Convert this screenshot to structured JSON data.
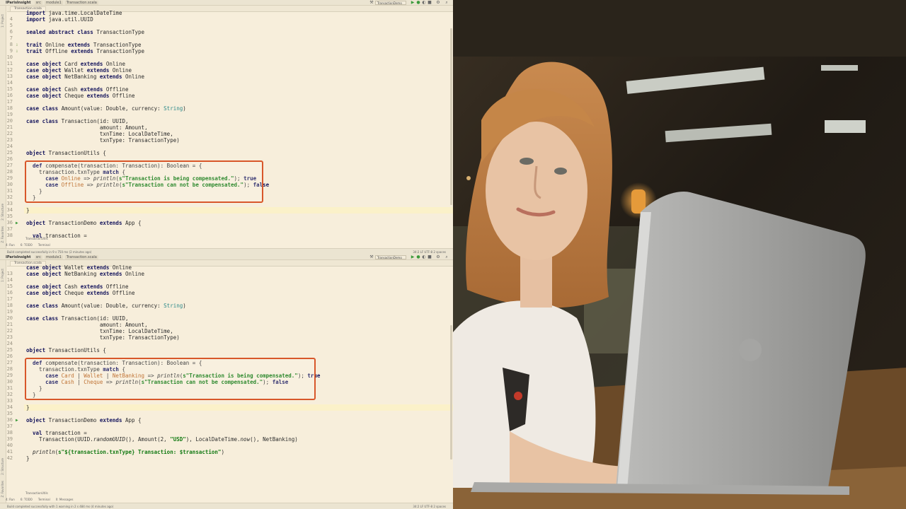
{
  "ide": {
    "breadcrumbs": [
      "IParisInsight",
      "src",
      "module1",
      "Transaction.scala"
    ],
    "tab_label": "Transaction.scala",
    "run_config": "TransactionDemo",
    "side_tool_windows": [
      "1: Project",
      "2: Structure",
      "Z: Favorites"
    ],
    "bottom_tool_windows": [
      "4: Run",
      "6: TODO",
      "Terminal"
    ],
    "bottom_tool_windows_full": [
      "4: Run",
      "6: TODO",
      "Terminal",
      "0: Messages"
    ],
    "structure_crumb": "TransactionUtils",
    "status_top": "Build completed successfully in 9 s 750 ms (2 minutes ago)",
    "status_bottom": "Build completed successfully with 1 warning in 2 s 484 ms (4 minutes ago)",
    "status_right_top": "34:2  LF  UTF-8  2 spaces",
    "status_right_bottom": "34:2  LF  UTF-8  2 spaces",
    "event_log": "Event Log",
    "colors": {
      "highlight_border": "#d8572a",
      "background": "#f7eedb",
      "keyword": "#14145c",
      "string": "#137a13"
    },
    "icons": [
      "run-icon",
      "debug-icon",
      "stop-icon",
      "search-icon"
    ]
  },
  "editor_top": {
    "lines": [
      {
        "n": "",
        "text": "import java.time.LocalDateTime"
      },
      {
        "n": "4",
        "text": "import java.util.UUID"
      },
      {
        "n": "5",
        "text": ""
      },
      {
        "n": "6",
        "text": "sealed abstract class TransactionType"
      },
      {
        "n": "7",
        "text": ""
      },
      {
        "n": "8",
        "text": "trait Online extends TransactionType"
      },
      {
        "n": "9",
        "text": "trait Offline extends TransactionType"
      },
      {
        "n": "10",
        "text": ""
      },
      {
        "n": "11",
        "text": "case object Card extends Online"
      },
      {
        "n": "12",
        "text": "case object Wallet extends Online"
      },
      {
        "n": "13",
        "text": "case object NetBanking extends Online"
      },
      {
        "n": "14",
        "text": ""
      },
      {
        "n": "15",
        "text": "case object Cash extends Offline"
      },
      {
        "n": "16",
        "text": "case object Cheque extends Offline"
      },
      {
        "n": "17",
        "text": ""
      },
      {
        "n": "18",
        "text": "case class Amount(value: Double, currency: String)"
      },
      {
        "n": "19",
        "text": ""
      },
      {
        "n": "20",
        "text": "case class Transaction(id: UUID,"
      },
      {
        "n": "21",
        "text": "                       amount: Amount,"
      },
      {
        "n": "22",
        "text": "                       txnTime: LocalDateTime,"
      },
      {
        "n": "23",
        "text": "                       txnType: TransactionType)"
      },
      {
        "n": "24",
        "text": ""
      },
      {
        "n": "25",
        "text": "object TransactionUtils {"
      },
      {
        "n": "26",
        "text": ""
      },
      {
        "n": "27",
        "text": "  def compensate(transaction: Transaction): Boolean = {"
      },
      {
        "n": "28",
        "text": "    transaction.txnType match {"
      },
      {
        "n": "29",
        "text": "      case Online => println(s\"Transaction is being compensated.\"); true"
      },
      {
        "n": "30",
        "text": "      case Offline => println(s\"Transaction can not be compensated.\"); false"
      },
      {
        "n": "31",
        "text": "    }"
      },
      {
        "n": "32",
        "text": "  }"
      },
      {
        "n": "33",
        "text": ""
      },
      {
        "n": "34",
        "text": "}"
      },
      {
        "n": "35",
        "text": ""
      },
      {
        "n": "36",
        "text": "object TransactionDemo extends App {"
      },
      {
        "n": "37",
        "text": ""
      },
      {
        "n": "38",
        "text": "  val transaction ="
      }
    ]
  },
  "editor_bottom": {
    "lines": [
      {
        "n": "",
        "text": "case object Wallet extends Online"
      },
      {
        "n": "13",
        "text": "case object NetBanking extends Online"
      },
      {
        "n": "14",
        "text": ""
      },
      {
        "n": "15",
        "text": "case object Cash extends Offline"
      },
      {
        "n": "16",
        "text": "case object Cheque extends Offline"
      },
      {
        "n": "17",
        "text": ""
      },
      {
        "n": "18",
        "text": "case class Amount(value: Double, currency: String)"
      },
      {
        "n": "19",
        "text": ""
      },
      {
        "n": "20",
        "text": "case class Transaction(id: UUID,"
      },
      {
        "n": "21",
        "text": "                       amount: Amount,"
      },
      {
        "n": "22",
        "text": "                       txnTime: LocalDateTime,"
      },
      {
        "n": "23",
        "text": "                       txnType: TransactionType)"
      },
      {
        "n": "24",
        "text": ""
      },
      {
        "n": "25",
        "text": "object TransactionUtils {"
      },
      {
        "n": "26",
        "text": ""
      },
      {
        "n": "27",
        "text": "  def compensate(transaction: Transaction): Boolean = {"
      },
      {
        "n": "28",
        "text": "    transaction.txnType match {"
      },
      {
        "n": "29",
        "text": "      case Card | Wallet | NetBanking => println(s\"Transaction is being compensated.\"); true"
      },
      {
        "n": "30",
        "text": "      case Cash | Cheque => println(s\"Transaction can not be compensated.\"); false"
      },
      {
        "n": "31",
        "text": "    }"
      },
      {
        "n": "32",
        "text": "  }"
      },
      {
        "n": "33",
        "text": ""
      },
      {
        "n": "34",
        "text": "}"
      },
      {
        "n": "35",
        "text": ""
      },
      {
        "n": "36",
        "text": "object TransactionDemo extends App {"
      },
      {
        "n": "37",
        "text": ""
      },
      {
        "n": "38",
        "text": "  val transaction ="
      },
      {
        "n": "39",
        "text": "    Transaction(UUID.randomUUID(), Amount(2, \"USD\"), LocalDateTime.now(), NetBanking)"
      },
      {
        "n": "40",
        "text": ""
      },
      {
        "n": "41",
        "text": "  println(s\"${transaction.txnType} Transaction: $transaction\")"
      },
      {
        "n": "42",
        "text": "}"
      }
    ]
  }
}
